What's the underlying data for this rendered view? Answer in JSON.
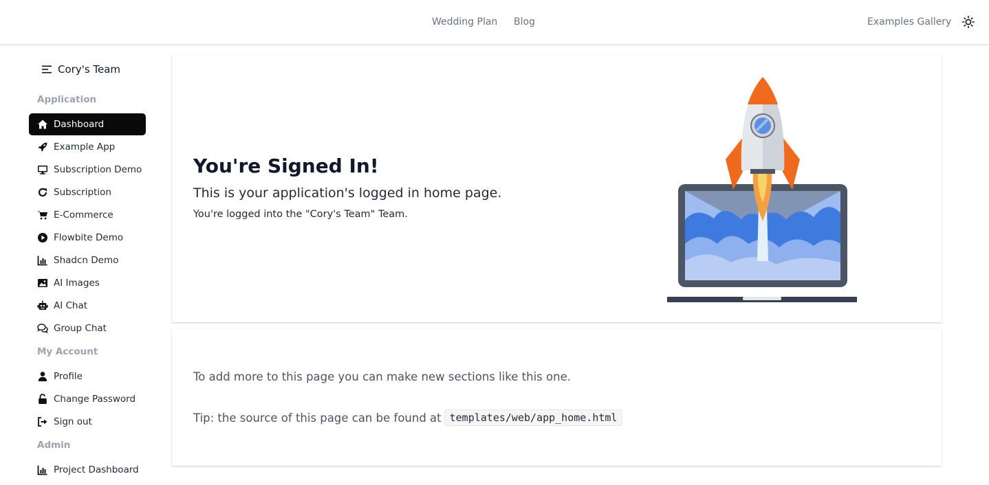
{
  "topnav": {
    "links": [
      "Wedding Plan",
      "Blog"
    ],
    "gallery_label": "Examples Gallery",
    "theme_icon": "sun-icon"
  },
  "sidebar": {
    "team_name": "Cory's Team",
    "sections": {
      "application": "Application",
      "my_account": "My Account",
      "admin": "Admin"
    },
    "items": [
      {
        "label": "Dashboard",
        "icon": "home-icon",
        "active": true
      },
      {
        "label": "Example App",
        "icon": "rocket-icon"
      },
      {
        "label": "Subscription Demo",
        "icon": "monitor-icon"
      },
      {
        "label": "Subscription",
        "icon": "refresh-icon"
      },
      {
        "label": "E-Commerce",
        "icon": "cart-icon"
      },
      {
        "label": "Flowbite Demo",
        "icon": "play-icon"
      },
      {
        "label": "Shadcn Demo",
        "icon": "bar-chart-icon"
      },
      {
        "label": "AI Images",
        "icon": "image-icon"
      },
      {
        "label": "AI Chat",
        "icon": "robot-icon"
      },
      {
        "label": "Group Chat",
        "icon": "chat-icon"
      },
      {
        "label": "Profile",
        "icon": "user-icon"
      },
      {
        "label": "Change Password",
        "icon": "unlock-icon"
      },
      {
        "label": "Sign out",
        "icon": "sign-out-icon"
      },
      {
        "label": "Project Dashboard",
        "icon": "bar-chart-icon"
      }
    ]
  },
  "hero": {
    "title": "You're Signed In!",
    "subtitle": "This is your application's logged in home page.",
    "team_line": "You're logged into the \"Cory's Team\" Team."
  },
  "section2": {
    "text": "To add more to this page you can make new sections like this one.",
    "tip_prefix": "Tip: the source of this page can be found at",
    "tip_code": "templates/web/app_home.html"
  },
  "colors": {
    "active_nav_bg": "#0a0a0a",
    "rocket_orange": "#ef6a1c",
    "sky_blue": "#5b8fe0"
  }
}
